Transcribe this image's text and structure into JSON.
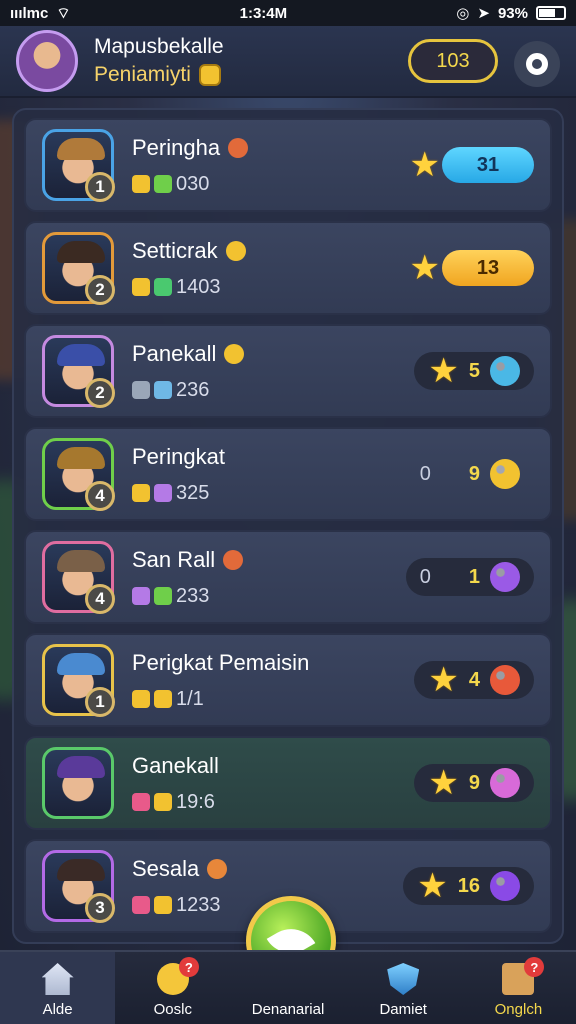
{
  "status_bar": {
    "carrier": "ııılmc",
    "time": "1:3:4M",
    "battery": "93%"
  },
  "header": {
    "title": "Mapusbekalle",
    "subtitle": "Peniamiyti",
    "coins": "103"
  },
  "players": [
    {
      "name": "Peringha",
      "rank": "1",
      "stats": "030",
      "score": "31",
      "score_style": "blue",
      "hat_color": "#b07a3a",
      "frame_color": "#4aa3e6"
    },
    {
      "name": "Setticrak",
      "rank": "2",
      "stats": "1403",
      "score": "13",
      "score_style": "gold",
      "hat_color": "#3b2a22",
      "frame_color": "#e39a3a"
    },
    {
      "name": "Panekall",
      "rank": "2",
      "stats": "236",
      "score": "5",
      "score_style": "dark",
      "hat_color": "#3a4fa8",
      "frame_color": "#c58ae0"
    },
    {
      "name": "Peringkat",
      "rank": "4",
      "stats": "325",
      "score": "9",
      "prefix": "0",
      "score_style": "plain",
      "hat_color": "#a6782e",
      "frame_color": "#6fcf4a"
    },
    {
      "name": "San Rall",
      "rank": "4",
      "stats": "233",
      "score": "1",
      "prefix": "0",
      "score_style": "dark",
      "hat_color": "#7a6048",
      "frame_color": "#e06da0"
    },
    {
      "name": "Perigkat Pemaisin",
      "rank": "1",
      "stats": "1/1",
      "score": "4",
      "score_style": "dark",
      "hat_color": "#4a8ad0",
      "frame_color": "#e8c34a"
    },
    {
      "name": "Ganekall",
      "rank": "",
      "stats": "19:6",
      "score": "9",
      "score_style": "dark",
      "hat_color": "#5a3a9a",
      "frame_color": "#5ac96a"
    },
    {
      "name": "Sesala",
      "rank": "3",
      "stats": "1233",
      "score": "16",
      "score_style": "dark",
      "hat_color": "#3a2a26",
      "frame_color": "#b36ae6"
    }
  ],
  "nav": [
    {
      "label": "Alde",
      "badge": ""
    },
    {
      "label": "Ooslc",
      "badge": "?"
    },
    {
      "label": "Denanarial",
      "badge": ""
    },
    {
      "label": "Damiet",
      "badge": ""
    },
    {
      "label": "Onglch",
      "badge": "?"
    }
  ],
  "colors": {
    "accent_gold": "#f4d84c",
    "accent_blue": "#3fc3f0",
    "panel": "#262d42"
  }
}
